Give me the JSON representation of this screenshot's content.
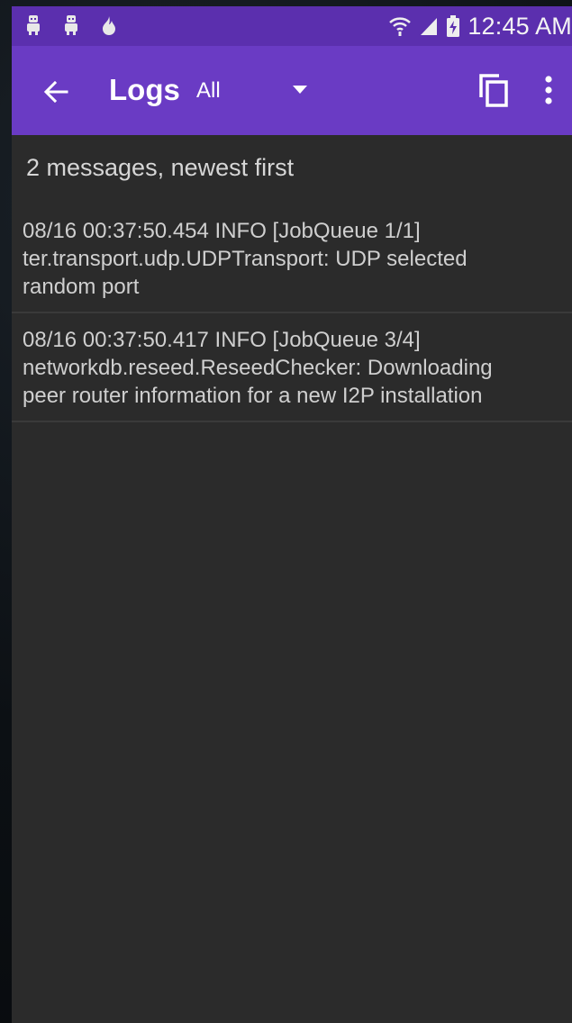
{
  "status_bar": {
    "time": "12:45 AM",
    "icons": [
      "robot-icon",
      "robot-icon",
      "flame-icon",
      "wifi-icon",
      "signal-icon",
      "battery-icon"
    ]
  },
  "app_bar": {
    "title": "Logs",
    "filter_value": "All",
    "icons": {
      "back": "arrow-back-icon",
      "copy": "copy-icon",
      "more": "more-vert-icon"
    }
  },
  "summary": "2 messages, newest first",
  "logs": [
    {
      "line1": "08/16 00:37:50.454 INFO  [JobQueue 1/1]",
      "line2": "ter.transport.udp.UDPTransport: UDP selected",
      "line3": "random port"
    },
    {
      "line1": "08/16 00:37:50.417 INFO  [JobQueue 3/4]",
      "line2": "networkdb.reseed.ReseedChecker: Downloading",
      "line3": "peer router information for a new I2P installation"
    }
  ],
  "colors": {
    "status_bar": "#5b2fae",
    "app_bar": "#6a3bc4",
    "background": "#2b2b2b",
    "text": "#cfcfcf"
  }
}
